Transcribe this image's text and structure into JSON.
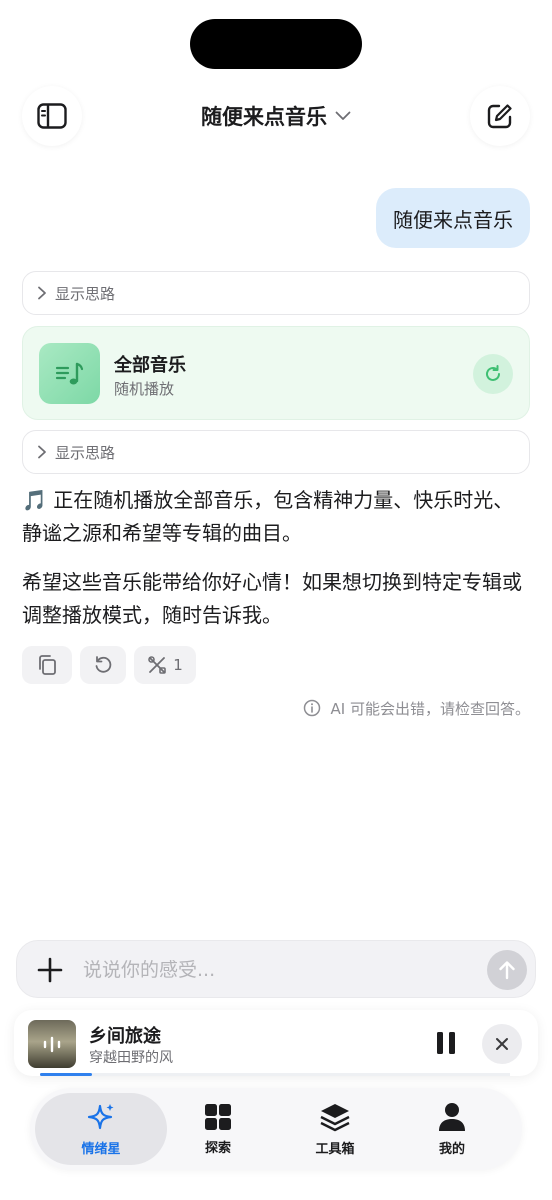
{
  "header": {
    "title": "随便来点音乐"
  },
  "chat": {
    "user_message": "随便来点音乐",
    "thinking_toggle_1": "显示思路",
    "thinking_toggle_2": "显示思路",
    "music_card": {
      "title": "全部音乐",
      "subtitle": "随机播放"
    },
    "paragraph_1": "🎵 正在随机播放全部音乐，包含精神力量、快乐时光、静谧之源和希望等专辑的曲目。",
    "paragraph_2": "希望这些音乐能带给你好心情！如果想切换到特定专辑或调整播放模式，随时告诉我。",
    "tools_count": "1",
    "disclaimer": "AI 可能会出错，请检查回答。"
  },
  "composer": {
    "placeholder": "说说你的感受..."
  },
  "player": {
    "track_title": "乡间旅途",
    "track_subtitle": "穿越田野的风",
    "progress": 0.11
  },
  "tabs": [
    {
      "label": "情绪星",
      "icon": "sparkle-icon",
      "active": true
    },
    {
      "label": "探索",
      "icon": "grid-icon",
      "active": false
    },
    {
      "label": "工具箱",
      "icon": "layers-icon",
      "active": false
    },
    {
      "label": "我的",
      "icon": "person-icon",
      "active": false
    }
  ],
  "colors": {
    "accent": "#1a73e8",
    "user_bubble": "#dcecfb",
    "music_card_bg": "#eefaf1",
    "music_green": "#3fbf73"
  }
}
